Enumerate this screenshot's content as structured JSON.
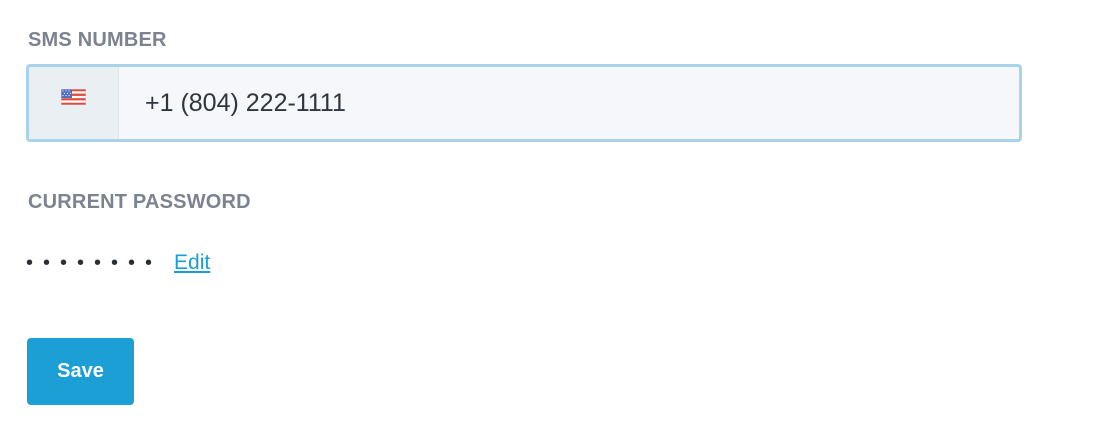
{
  "sms_number": {
    "label": "SMS NUMBER",
    "country_flag_icon": "us-flag-icon",
    "value": "+1 (804) 222-1111"
  },
  "current_password": {
    "label": "CURRENT PASSWORD",
    "masked_value": "••••••••",
    "edit_label": "Edit"
  },
  "actions": {
    "save_label": "Save"
  },
  "colors": {
    "label": "#7b8390",
    "field_border": "#a9d3e8",
    "field_background": "#f5f7fa",
    "link": "#1a9fd4",
    "primary_button": "#1b9fd5"
  }
}
